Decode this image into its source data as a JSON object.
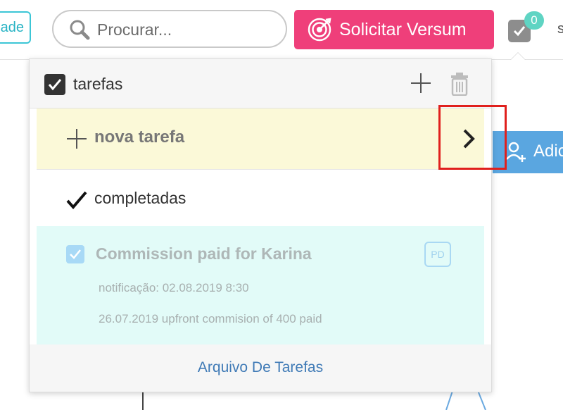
{
  "topbar": {
    "left_tag": "ade",
    "search_placeholder": "Procurar...",
    "versum_button": "Solicitar Versum",
    "task_badge_count": "0",
    "user_initial": "s"
  },
  "background": {
    "add_button": "Adic"
  },
  "panel": {
    "title": "tarefas",
    "new_task_label": "nova tarefa",
    "completed_label": "completadas",
    "tasks": [
      {
        "title": "Commission paid for Karina",
        "assignee_badge": "PD",
        "notification": "notificação: 02.08.2019 8:30",
        "description": "26.07.2019 upfront commision of 400 paid"
      }
    ],
    "footer_link": "Arquivo De Tarefas"
  },
  "colors": {
    "accent_pink": "#ef3f7a",
    "highlight_red": "#e0201d",
    "new_task_bg": "#fbf9d8",
    "task_bg": "#e2fbf8",
    "link_blue": "#3f7ab6"
  }
}
